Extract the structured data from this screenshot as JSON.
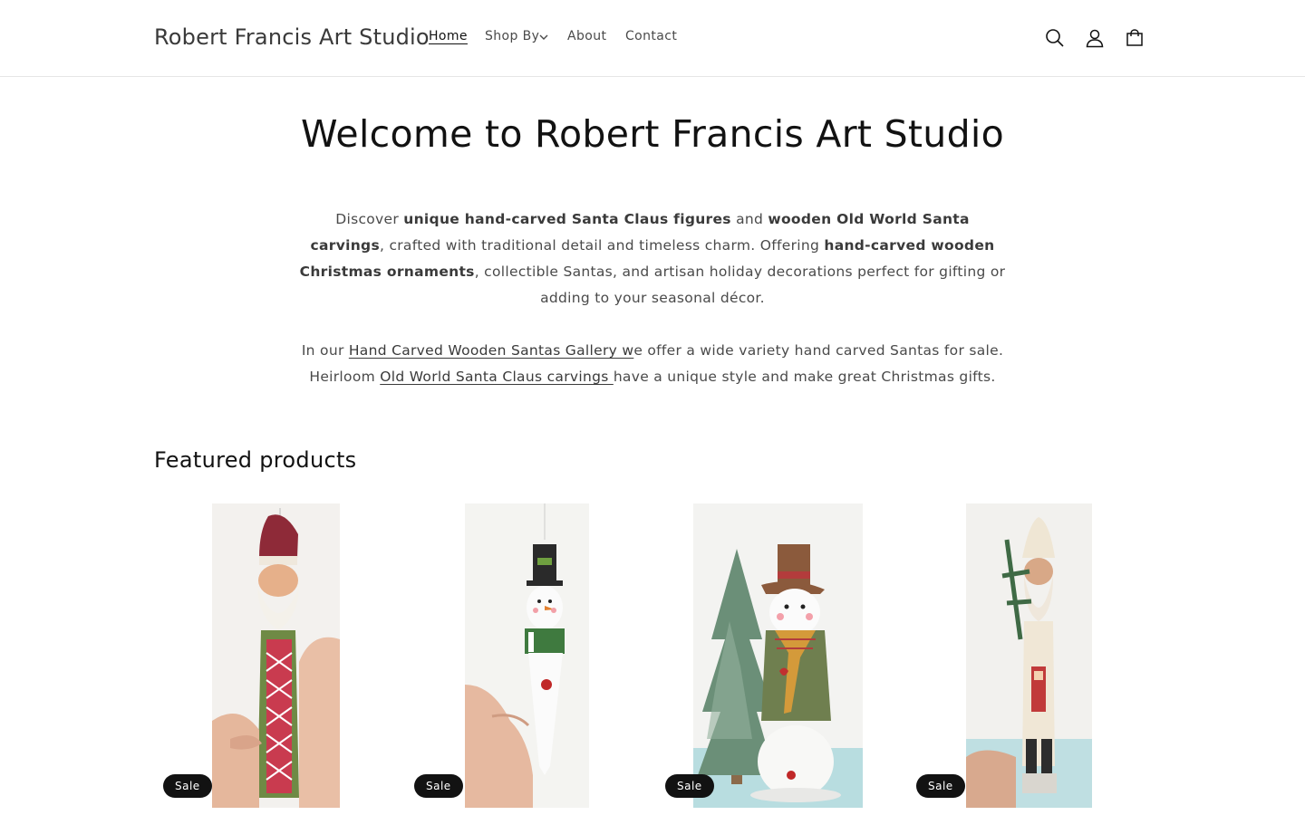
{
  "header": {
    "logo": "Robert Francis Art Studio",
    "nav": [
      {
        "label": "Home"
      },
      {
        "label": "Shop By"
      },
      {
        "label": "About"
      },
      {
        "label": "Contact"
      }
    ],
    "icons": [
      "search-icon",
      "account-icon",
      "cart-icon"
    ]
  },
  "hero": {
    "title": "Welcome to Robert Francis Art Studio",
    "p1": {
      "t1": "Discover ",
      "b1": "unique hand-carved Santa Claus figures",
      "t2": " and ",
      "b2": "wooden Old World Santa carvings",
      "t3": ", crafted with traditional detail and timeless charm. Offering ",
      "b3": "hand-carved wooden Christmas ornaments",
      "t4": ", collectible Santas, and artisan holiday decorations perfect for gifting or adding to your seasonal décor."
    },
    "p2": {
      "t1": "In our ",
      "link1": "Hand Carved Wooden Santas Gallery  w",
      "t2": "e offer a wide variety hand carved Santas for sale. Heirloom ",
      "link2": "Old World Santa Claus carvings ",
      "t3": "have a unique style and make great Christmas gifts."
    }
  },
  "featured": {
    "title": "Featured products",
    "products": [
      {
        "badge": "Sale",
        "image": "santa-ornament-photo"
      },
      {
        "badge": "Sale",
        "image": "snowman-ornament-photo"
      },
      {
        "badge": "Sale",
        "image": "snowman-figure-photo"
      },
      {
        "badge": "Sale",
        "image": "santa-tall-carving-photo"
      }
    ]
  },
  "colors": {
    "text": "#121212",
    "muted": "#4a4a4a",
    "badge_bg": "#121212",
    "badge_text": "#ffffff"
  }
}
